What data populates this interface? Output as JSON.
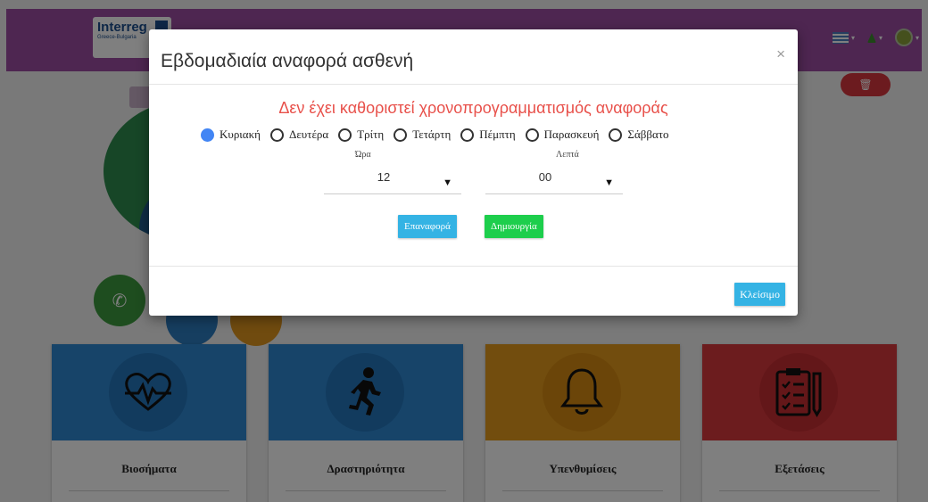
{
  "app": {
    "logo": {
      "title": "Interreg",
      "subtitle": "Greece-Bulgaria"
    },
    "nav": [
      {
        "icon": "flag-icon"
      },
      {
        "icon": "bell-icon"
      },
      {
        "icon": "avatar-icon"
      }
    ],
    "cards": [
      {
        "label": "Βιοσήματα",
        "icon": "heart-pulse-icon",
        "color": "#2e88d2"
      },
      {
        "label": "Δραστηριότητα",
        "icon": "running-person-icon",
        "color": "#2e88d2"
      },
      {
        "label": "Υπενθυμίσεις",
        "icon": "bell-outline-icon",
        "color": "#e59a1c"
      },
      {
        "label": "Εξετάσεις",
        "icon": "clipboard-checklist-icon",
        "color": "#d9383c"
      }
    ]
  },
  "modal": {
    "title": "Εβδομαδιαία αναφορά ασθενή",
    "close_symbol": "×",
    "warning": "Δεν έχει καθοριστεί χρονοπρογραμματισμός αναφοράς",
    "days": [
      {
        "label": "Κυριακή",
        "checked": true
      },
      {
        "label": "Δευτέρα",
        "checked": false
      },
      {
        "label": "Τρίτη",
        "checked": false
      },
      {
        "label": "Τετάρτη",
        "checked": false
      },
      {
        "label": "Πέμπτη",
        "checked": false
      },
      {
        "label": "Παρασκευή",
        "checked": false
      },
      {
        "label": "Σάββατο",
        "checked": false
      }
    ],
    "hour": {
      "label": "Ώρα",
      "value": "12"
    },
    "minutes": {
      "label": "Λεπτά",
      "value": "00"
    },
    "reset_label": "Επαναφορά",
    "create_label": "Δημιουργία",
    "close_label": "Κλείσιμο"
  }
}
